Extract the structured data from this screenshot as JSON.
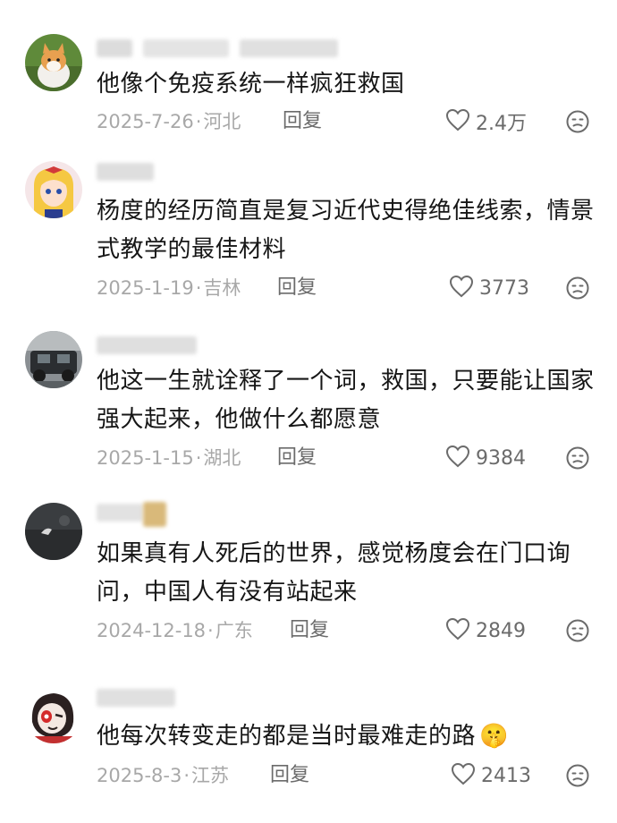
{
  "comments": [
    {
      "text": "他像个免疫系统一样疯狂救国",
      "date": "2025-7-26",
      "location": "河北",
      "reply_label": "回复",
      "likes": "2.4万",
      "avatar_icon": "cat-avatar-icon"
    },
    {
      "text": "杨度的经历简直是复习近代史得绝佳线索，情景式教学的最佳材料",
      "date": "2025-1-19",
      "location": "吉林",
      "reply_label": "回复",
      "likes": "3773",
      "avatar_icon": "anime-girl-avatar-icon"
    },
    {
      "text": "他这一生就诠释了一个词，救国，只要能让国家强大起来，他做什么都愿意",
      "date": "2025-1-15",
      "location": "湖北",
      "reply_label": "回复",
      "likes": "9384",
      "avatar_icon": "car-avatar-icon"
    },
    {
      "text": "如果真有人死后的世界，感觉杨度会在门口询问，中国人有没有站起来",
      "date": "2024-12-18",
      "location": "广东",
      "reply_label": "回复",
      "likes": "2849",
      "avatar_icon": "dark-photo-avatar-icon"
    },
    {
      "text": "他每次转变走的都是当时最难走的路",
      "emoji": "🤫",
      "date": "2025-8-3",
      "location": "江苏",
      "reply_label": "回复",
      "likes": "2413",
      "avatar_icon": "cartoon-face-avatar-icon"
    }
  ],
  "colors": {
    "meta_gray": "#a8a8a8",
    "action_gray": "#6b6b6b",
    "text": "#161616"
  }
}
